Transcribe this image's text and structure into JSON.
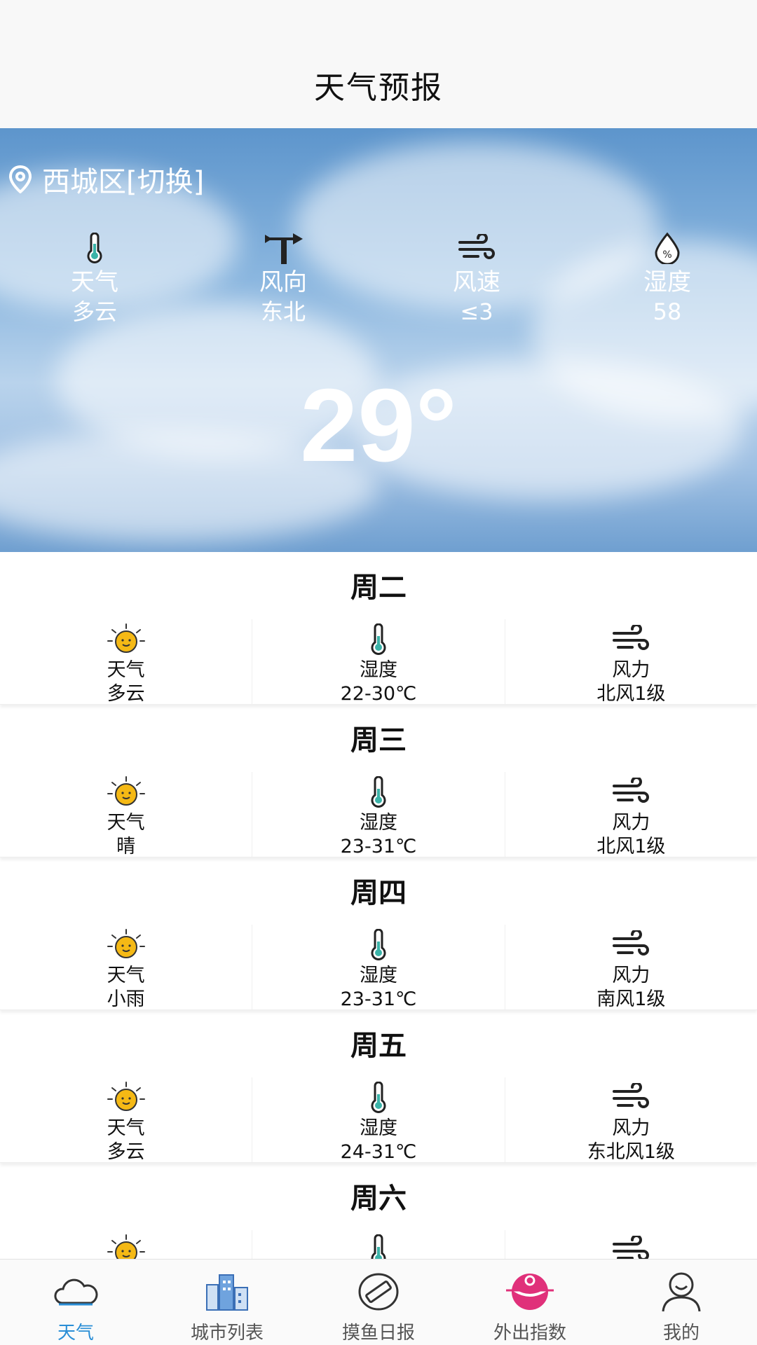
{
  "header": {
    "title": "天气预报"
  },
  "current": {
    "location": "西城区[切换]",
    "stats": [
      {
        "label": "天气",
        "value": "多云",
        "icon": "thermometer-icon"
      },
      {
        "label": "风向",
        "value": "东北",
        "icon": "wind-vane-icon"
      },
      {
        "label": "风速",
        "value": "≤3",
        "icon": "wind-icon"
      },
      {
        "label": "湿度",
        "value": "58",
        "icon": "humidity-icon"
      }
    ],
    "temperature": "29°"
  },
  "forecast": [
    {
      "day": "周二",
      "weather_label": "天气",
      "weather": "多云",
      "temp_label": "湿度",
      "temp": "22-30℃",
      "wind_label": "风力",
      "wind": "北风1级"
    },
    {
      "day": "周三",
      "weather_label": "天气",
      "weather": "晴",
      "temp_label": "湿度",
      "temp": "23-31℃",
      "wind_label": "风力",
      "wind": "北风1级"
    },
    {
      "day": "周四",
      "weather_label": "天气",
      "weather": "小雨",
      "temp_label": "湿度",
      "temp": "23-31℃",
      "wind_label": "风力",
      "wind": "南风1级"
    },
    {
      "day": "周五",
      "weather_label": "天气",
      "weather": "多云",
      "temp_label": "湿度",
      "temp": "24-31℃",
      "wind_label": "风力",
      "wind": "东北风1级"
    },
    {
      "day": "周六",
      "weather_label": "",
      "weather": "",
      "temp_label": "",
      "temp": "",
      "wind_label": "",
      "wind": ""
    }
  ],
  "tabs": [
    {
      "label": "天气",
      "icon": "cloud-icon",
      "active": true
    },
    {
      "label": "城市列表",
      "icon": "city-icon",
      "active": false
    },
    {
      "label": "摸鱼日报",
      "icon": "ruler-icon",
      "active": false
    },
    {
      "label": "外出指数",
      "icon": "index-icon",
      "active": false
    },
    {
      "label": "我的",
      "icon": "user-icon",
      "active": false
    }
  ],
  "colors": {
    "accent": "#2a8ed6",
    "hero_sky": "#8ab6df",
    "sun": "#f5b915",
    "pink": "#e0307a"
  }
}
